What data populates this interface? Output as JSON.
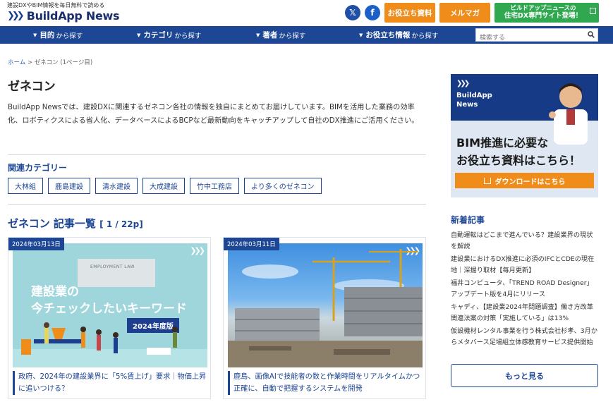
{
  "header": {
    "tagline": "建設DXやBIM情報を毎日無料で読める",
    "logo_text": "BuildApp News",
    "social": {
      "x_icon": "x-icon",
      "facebook_icon": "facebook-icon"
    },
    "buttons": {
      "docs": "お役立ち資料",
      "magazine": "メルマガ",
      "housing_line1": "ビルドアップニュースの",
      "housing_line2": "住宅DX専門サイト登場！"
    }
  },
  "nav": {
    "items": [
      {
        "label": "目的",
        "suffix": "から探す"
      },
      {
        "label": "カテゴリ",
        "suffix": "から探す"
      },
      {
        "label": "著者",
        "suffix": "から探す"
      },
      {
        "label": "お役立ち情報",
        "suffix": "から探す"
      }
    ],
    "search_placeholder": "検索する"
  },
  "breadcrumb": {
    "home": "ホーム",
    "separator": ">",
    "current": "ゼネコン (1ページ目)"
  },
  "page": {
    "title": "ゼネコン",
    "intro": "BuildApp Newsでは、建設DXに関連するゼネコン各社の情報を独自にまとめてお届けしています。BIMを活用した業務の効率化、ロボティクスによる省人化、データベースによるBCPなど最新動向をキャッチアップして自社のDX推進にご活用ください。"
  },
  "related": {
    "label": "関連カテゴリー",
    "tags": [
      "大林組",
      "鹿島建設",
      "清水建設",
      "大成建設",
      "竹中工務店",
      "より多くのゼネコン"
    ]
  },
  "article_list": {
    "title": "ゼネコン 記事一覧",
    "count": "[ 1 / 22p]",
    "articles": [
      {
        "date": "2024年03月13日",
        "thumb_board": "EMPLOYMENT LAW",
        "thumb_line1": "建設業の",
        "thumb_line2": "今チェックしたいキーワード",
        "thumb_badge": "2024年度版",
        "title": "政府、2024年の建設業界に「5%賃上げ」要求｜物価上昇に追いつける？"
      },
      {
        "date": "2024年03月11日",
        "title": "鹿島、画像AIで技能者の数と作業時間をリアルタイムかつ正確に、自動で把握するシステムを開発"
      }
    ]
  },
  "sidebar": {
    "ad": {
      "brand_line1": "BuildApp",
      "brand_line2": "News",
      "line1": "BIM推進に必要な",
      "line2": "お役立ち資料はこちら！",
      "download": "ダウンロードはこちら"
    },
    "news_title": "新着記事",
    "news": [
      "自動運転はどこまで進んでいる？建設業界の現状を解説",
      "建設業におけるDX推進に必須のIFCとCDEの現在地｜深掘り取材【毎月更新】",
      "福井コンピュータ、「TREND ROAD Designer」アップデート版を4月にリリース",
      "キャディ、【建設業2024年問題調査】働き方改革関連法案の対策「実施している」は13%",
      "仮設機材レンタル事業を行う株式会社杉孝、3月からメタバース足場組立体感教育サービス提供開始"
    ],
    "more_button": "もっと見る"
  },
  "colors": {
    "brand_navy": "#1d4694",
    "accent_orange": "#f08c1a",
    "accent_green": "#2fa84f"
  }
}
